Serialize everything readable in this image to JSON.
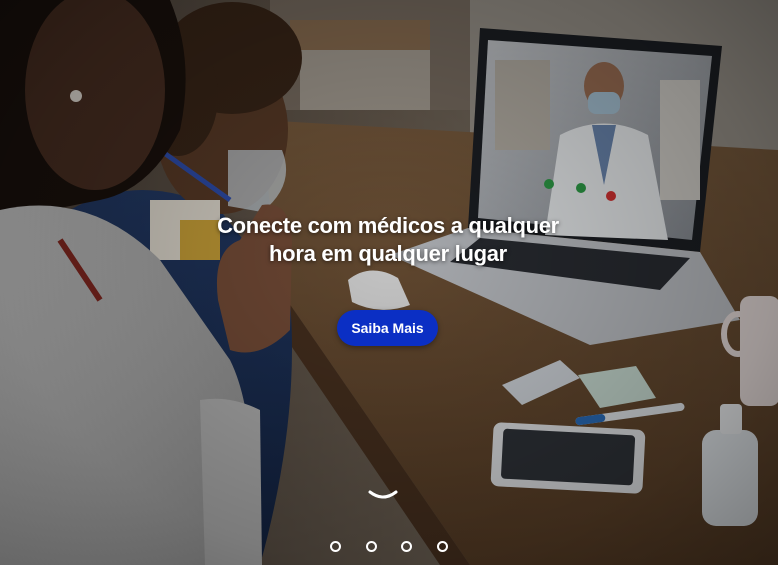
{
  "hero": {
    "headline_line1": "Conecte com médicos a qualquer",
    "headline_line2": "hora em qualquer lugar",
    "cta_label": "Saiba Mais"
  },
  "carousel": {
    "slide_count": 4
  },
  "colors": {
    "cta_background": "#0b2fc4",
    "text": "#ffffff"
  },
  "icons": {
    "scroll": "chevron-down-icon",
    "indicator": "circle-outline-icon"
  }
}
